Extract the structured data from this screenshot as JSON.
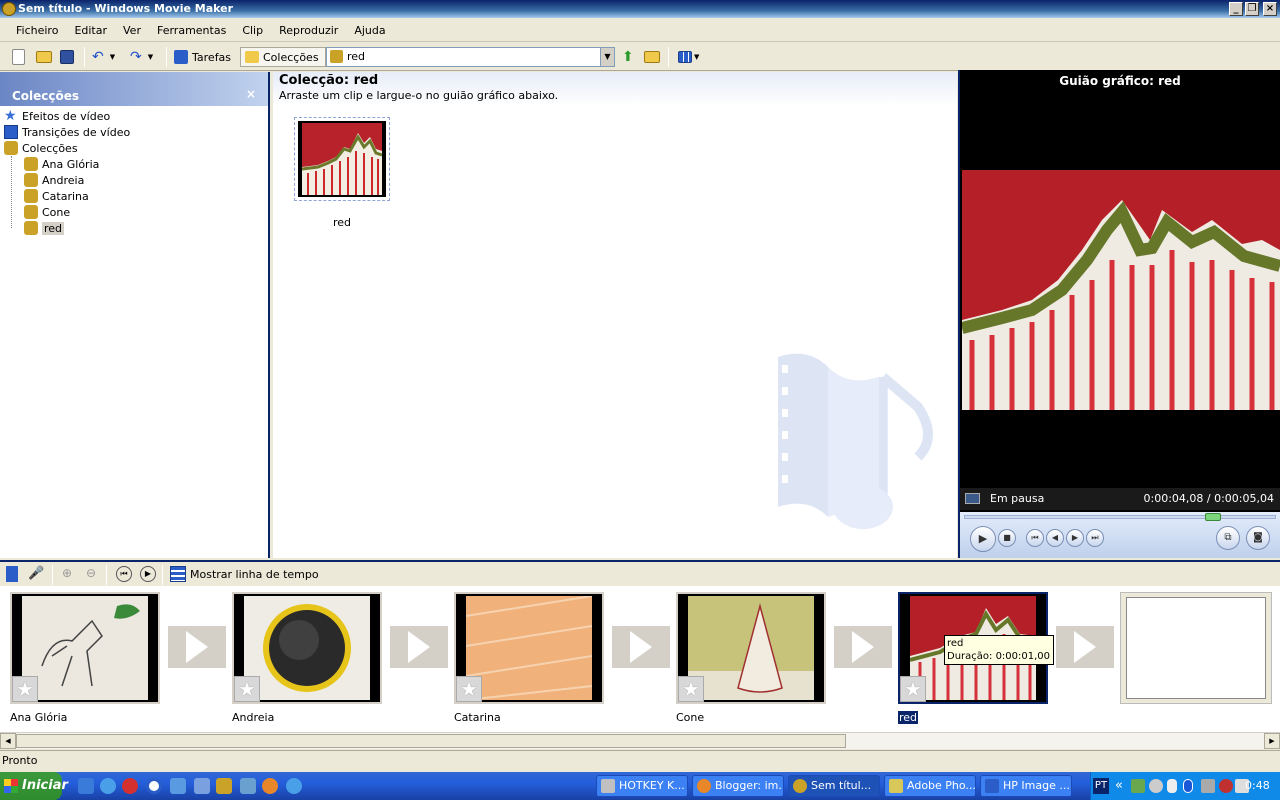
{
  "window": {
    "title": "Sem título - Windows Movie Maker"
  },
  "menu": [
    "Ficheiro",
    "Editar",
    "Ver",
    "Ferramentas",
    "Clip",
    "Reproduzir",
    "Ajuda"
  ],
  "toolbar": {
    "tasks_label": "Tarefas",
    "collections_label": "Colecções",
    "collection_value": "red"
  },
  "left_pane": {
    "title": "Colecções",
    "close_glyph": "×",
    "items": [
      {
        "label": "Efeitos de vídeo",
        "icon": "star-icon"
      },
      {
        "label": "Transições de vídeo",
        "icon": "transition-icon"
      },
      {
        "label": "Colecções",
        "icon": "collection-icon"
      },
      {
        "label": "Ana Glória",
        "icon": "collection-icon"
      },
      {
        "label": "Andreia",
        "icon": "collection-icon"
      },
      {
        "label": "Catarina",
        "icon": "collection-icon"
      },
      {
        "label": "Cone",
        "icon": "collection-icon"
      },
      {
        "label": "red",
        "icon": "collection-icon",
        "selected": true
      }
    ]
  },
  "center": {
    "title": "Colecção: red",
    "subtitle": "Arraste um clip e largue-o no guião gráfico abaixo.",
    "clips": [
      {
        "label": "red"
      }
    ]
  },
  "preview": {
    "title": "Guião gráfico: red",
    "status": "Em pausa",
    "time": "0:00:04,08 / 0:00:05,04",
    "seek_fraction": 0.81
  },
  "storyboard_toolbar": {
    "timeline_label": "Mostrar linha de tempo"
  },
  "storyboard": {
    "clips": [
      {
        "label": "Ana Glória"
      },
      {
        "label": "Andreia"
      },
      {
        "label": "Catarina"
      },
      {
        "label": "Cone"
      },
      {
        "label": "red",
        "selected": true
      }
    ],
    "tooltip": {
      "name": "red",
      "duration": "Duração:  0:00:01,00"
    }
  },
  "status_bar": {
    "text": "Pronto"
  },
  "taskbar": {
    "start": "Iniciar",
    "tasks": [
      {
        "label": "HOTKEY K..."
      },
      {
        "label": "Blogger: im..."
      },
      {
        "label": "Sem títul...",
        "active": true
      },
      {
        "label": "Adobe Pho..."
      },
      {
        "label": "HP Image ..."
      }
    ],
    "language": "PT",
    "tray_chevron": "«",
    "clock": "0:48"
  }
}
